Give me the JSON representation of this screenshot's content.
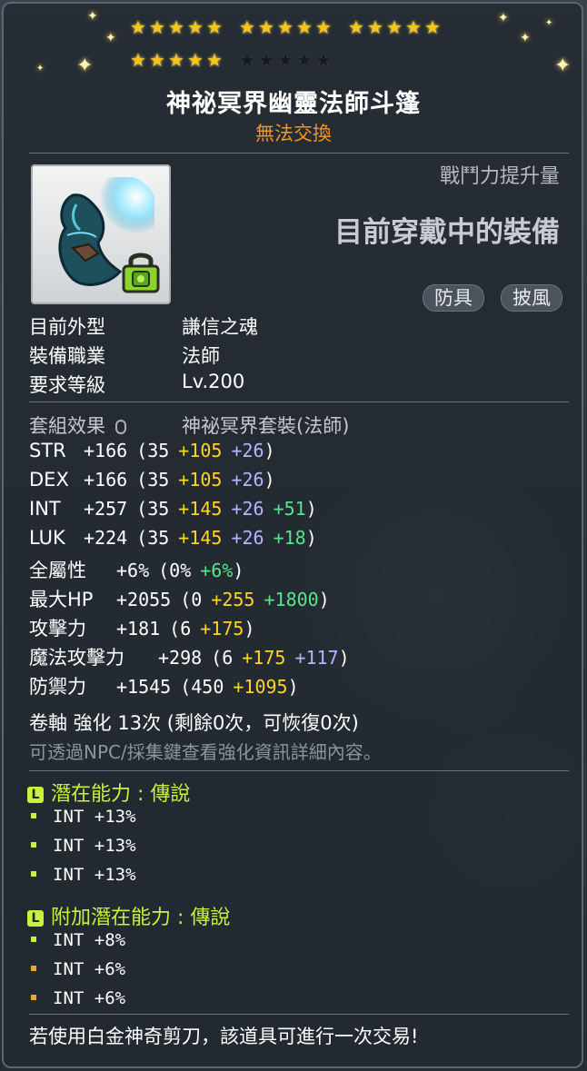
{
  "stars": {
    "total": 25,
    "filled": 20
  },
  "item": {
    "name": "神祕冥界幽靈法師斗篷",
    "trade_status": "無法交換",
    "power_label": "戰鬥力提升量",
    "equipped_label": "目前穿戴中的裝備",
    "tags": [
      "防具",
      "披風"
    ]
  },
  "info": [
    {
      "label": "目前外型",
      "value": "謙信之魂"
    },
    {
      "label": "裝備職業",
      "value": "法師"
    },
    {
      "label": "要求等級",
      "value": "Lv.200"
    }
  ],
  "set": {
    "label": "套組效果",
    "value": "神祕冥界套裝(法師)"
  },
  "stats": [
    {
      "name": "STR",
      "total": "+166",
      "base": "(35",
      "flame": "+105",
      "star": "+26",
      "scroll": "",
      "close": ")"
    },
    {
      "name": "DEX",
      "total": "+166",
      "base": "(35",
      "flame": "+105",
      "star": "+26",
      "scroll": "",
      "close": ")"
    },
    {
      "name": "INT",
      "total": "+257",
      "base": "(35",
      "flame": "+145",
      "star": "+26",
      "scroll": "+51",
      "close": ")"
    },
    {
      "name": "LUK",
      "total": "+224",
      "base": "(35",
      "flame": "+145",
      "star": "+26",
      "scroll": "+18",
      "close": ")"
    }
  ],
  "stats2": [
    {
      "name": "全屬性",
      "total": "+6%",
      "base": "(0%",
      "flame": "",
      "star": "",
      "scroll": "+6%",
      "close": ")"
    },
    {
      "name": "最大HP",
      "total": "+2055",
      "base": "(0",
      "flame": "+255",
      "star": "",
      "scroll": "+1800",
      "close": ")"
    },
    {
      "name": "攻擊力",
      "total": "+181",
      "base": "(6",
      "flame": "+175",
      "star": "",
      "scroll": "",
      "close": ")"
    },
    {
      "name": "魔法攻擊力",
      "total": "+298",
      "base": "(6",
      "flame": "+175",
      "star": "+117",
      "scroll": "",
      "close": ")"
    },
    {
      "name": "防禦力",
      "total": "+1545",
      "base": "(450",
      "flame": "+1095",
      "star": "",
      "scroll": "",
      "close": ")"
    }
  ],
  "enhance": {
    "line": "卷軸 強化 13次 (剩餘0次，可恢復0次)",
    "hint": "可透過NPC/採集鍵查看強化資訊詳細內容。"
  },
  "potential": {
    "badge": "L",
    "title": "潛在能力 : 傳說",
    "lines": [
      "INT +13%",
      "INT +13%",
      "INT +13%"
    ],
    "bullet_color": "#c8f03c"
  },
  "bonus_potential": {
    "badge": "L",
    "title": "附加潛在能力 : 傳說",
    "lines": [
      "INT +8%",
      "INT +6%",
      "INT +6%"
    ],
    "bullet_colors": [
      "#c8f03c",
      "#f5a623",
      "#f5a623"
    ]
  },
  "footer": "若使用白金神奇剪刀，該道具可進行一次交易!"
}
